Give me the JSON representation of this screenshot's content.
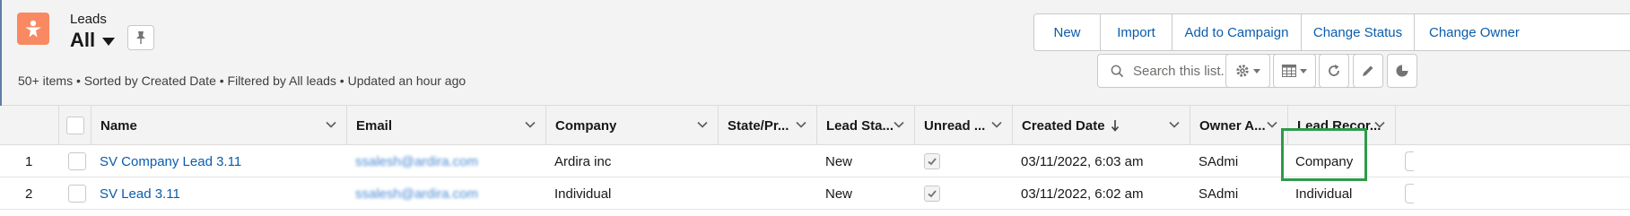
{
  "header": {
    "object_label": "Leads",
    "view_name": "All",
    "object_icon": "lead-icon",
    "summary": "50+ items • Sorted by Created Date • Filtered by All leads • Updated an hour ago"
  },
  "actions": [
    "New",
    "Import",
    "Add to Campaign",
    "Change Status",
    "Change Owner"
  ],
  "search": {
    "placeholder": "Search this list...",
    "value": ""
  },
  "toolbar_icons": [
    "gear-icon",
    "table-icon",
    "refresh-icon",
    "edit-icon",
    "chart-icon"
  ],
  "columns": [
    "Name",
    "Email",
    "Company",
    "State/Pr...",
    "Lead Sta...",
    "Unread ...",
    "Created Date",
    "Owner A...",
    "Lead Recor..."
  ],
  "sort": {
    "column": "Created Date",
    "direction": "descending"
  },
  "rows": [
    {
      "num": "1",
      "name": "SV Company Lead 3.11",
      "email": "ssalesh@ardira.com",
      "company": "Ardira inc",
      "state": "",
      "status": "New",
      "unread": true,
      "created": "03/11/2022, 6:03 am",
      "owner": "SAdmi",
      "record_type": "Company"
    },
    {
      "num": "2",
      "name": "SV Lead 3.11",
      "email": "ssalesh@ardira.com",
      "company": "Individual",
      "state": "",
      "status": "New",
      "unread": true,
      "created": "03/11/2022, 6:02 am",
      "owner": "SAdmi",
      "record_type": "Individual"
    }
  ],
  "colors": {
    "accent": "#0b5cab",
    "lead_icon": "#f88962",
    "highlight": "#2e9a4a",
    "header_bg": "#f3f3f3"
  }
}
